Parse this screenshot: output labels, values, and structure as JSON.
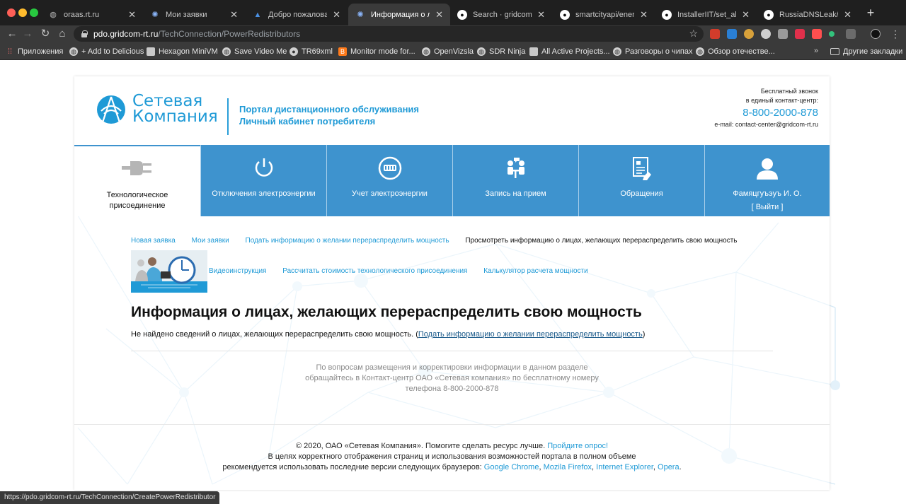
{
  "browser": {
    "tabs": [
      {
        "title": "oraas.rt.ru",
        "icon": "globe-icon"
      },
      {
        "title": "Мои заявки",
        "icon": "portal-icon"
      },
      {
        "title": "Добро пожаловать",
        "icon": "triangle-icon"
      },
      {
        "title": "Информация о лицах",
        "icon": "portal-icon"
      },
      {
        "title": "Search · gridcom-rt.r",
        "icon": "github-icon"
      },
      {
        "title": "smartcityapi/energy_k",
        "icon": "github-icon"
      },
      {
        "title": "InstallerIIT/set_all.reg",
        "icon": "github-icon"
      },
      {
        "title": "RussiaDNSLeak/tatar",
        "icon": "github-icon"
      }
    ],
    "active_tab_index": 3,
    "address": {
      "host": "pdo.gridcom-rt.ru",
      "path": "/TechConnection/PowerRedistributors"
    },
    "bookmarks": [
      {
        "label": "Приложения"
      },
      {
        "label": "+ Add to Delicious"
      },
      {
        "label": "Hexagon MiniVM"
      },
      {
        "label": "Save Video Me"
      },
      {
        "label": "TR69xml"
      },
      {
        "label": "Monitor mode for..."
      },
      {
        "label": "OpenVizsla"
      },
      {
        "label": "SDR Ninja"
      },
      {
        "label": "All Active Projects..."
      },
      {
        "label": "Разговоры о чипах"
      },
      {
        "label": "Обзор отечестве..."
      }
    ],
    "bookmarks_more": "»",
    "other_bookmarks": "Другие закладки",
    "status_url": "https://pdo.gridcom-rt.ru/TechConnection/CreatePowerRedistributor"
  },
  "header": {
    "logo_line1": "Сетевая",
    "logo_line2": "Компания",
    "portal_line1": "Портал дистанционного обслуживания",
    "portal_line2": "Личный кабинет потребителя",
    "contact_line1": "Бесплатный звонок",
    "contact_line2": "в единый контакт-центр:",
    "phone": "8-800-2000-878",
    "email": "e-mail: contact-center@gridcom-rt.ru"
  },
  "nav": {
    "items": [
      {
        "line1": "Технологическое",
        "line2": "присоединение",
        "icon": "plug-icon"
      },
      {
        "label": "Отключения электроэнергии",
        "icon": "power-icon"
      },
      {
        "label": "Учет электроэнергии",
        "icon": "meter-icon"
      },
      {
        "label": "Запись на прием",
        "icon": "appointment-icon"
      },
      {
        "label": "Обращения",
        "icon": "document-icon"
      },
      {
        "label": "Фамяцгуъэуъ И. О.",
        "logout": "[ Выйти ]",
        "icon": "user-icon"
      }
    ]
  },
  "breadcrumbs": [
    "Новая заявка",
    "Мои заявки",
    "Подать информацию о желании перераспределить мощность"
  ],
  "breadcrumb_current": "Просмотреть информацию о лицах, желающих перераспределить свою мощность",
  "links": [
    "Видеоинструкция",
    "Рассчитать стоимость технологического присоединения",
    "Калькулятор расчета мощности"
  ],
  "main": {
    "title": "Информация о лицах, желающих перераспределить свою мощность",
    "notice_text": "Не найдено сведений о лицах, желающих перераспределить свою мощность. (",
    "notice_link": "Подать информацию о желании перераспределить мощность",
    "notice_end": ")",
    "help_line1": "По вопросам размещения и корректировки информации в данном разделе",
    "help_line2": "обращайтесь в Контакт-центр ОАО «Сетевая компания» по бесплатному номеру",
    "help_line3": "телефона 8-800-2000-878"
  },
  "footer": {
    "copyright": "© 2020, ОАО «Сетевая Компания». Помогите сделать ресурс лучше. ",
    "survey_link": "Пройдите опрос!",
    "line2": "В целях корректного отображения страниц и использования возможностей портала в полном объеме",
    "line3": "рекомендуется использовать последние версии следующих браузеров: ",
    "browsers": [
      "Google Chrome",
      "Mozila Firefox",
      "Internet Explorer",
      "Opera"
    ],
    "comma": ", ",
    "period": "."
  },
  "colors": {
    "brand_blue": "#1f9ad6",
    "nav_blue": "#3e93ce"
  }
}
